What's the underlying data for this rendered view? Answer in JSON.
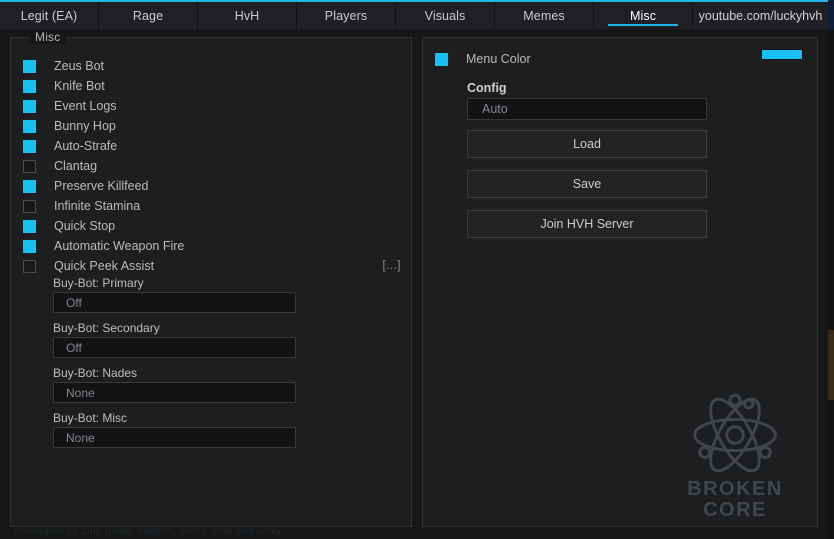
{
  "window": {
    "accent_color": "#20b4e8",
    "background": "#151719"
  },
  "tabs": [
    {
      "label": "Legit (EA)",
      "active": false
    },
    {
      "label": "Rage",
      "active": false
    },
    {
      "label": "HvH",
      "active": false
    },
    {
      "label": "Players",
      "active": false
    },
    {
      "label": "Visuals",
      "active": false
    },
    {
      "label": "Memes",
      "active": false
    },
    {
      "label": "Misc",
      "active": true
    }
  ],
  "tab_url": "youtube.com/luckyhvh",
  "left_panel": {
    "title": "Misc",
    "checkboxes": [
      {
        "label": "Zeus Bot",
        "checked": true
      },
      {
        "label": "Knife Bot",
        "checked": true
      },
      {
        "label": "Event Logs",
        "checked": true
      },
      {
        "label": "Bunny Hop",
        "checked": true
      },
      {
        "label": "Auto-Strafe",
        "checked": true
      },
      {
        "label": "Clantag",
        "checked": false
      },
      {
        "label": "Preserve Killfeed",
        "checked": true
      },
      {
        "label": "Infinite Stamina",
        "checked": false
      },
      {
        "label": "Quick Stop",
        "checked": true
      },
      {
        "label": "Automatic Weapon Fire",
        "checked": true
      },
      {
        "label": "Quick Peek Assist",
        "checked": false,
        "more": "[...]"
      }
    ],
    "fields": [
      {
        "label": "Buy-Bot: Primary",
        "value": "Off"
      },
      {
        "label": "Buy-Bot: Secondary",
        "value": "Off"
      },
      {
        "label": "Buy-Bot: Nades",
        "value": "None"
      },
      {
        "label": "Buy-Bot: Misc",
        "value": "None"
      }
    ]
  },
  "right_panel": {
    "menu_color": {
      "label": "Menu Color",
      "checked": true,
      "swatch_color": "#18c0f4"
    },
    "config": {
      "label": "Config",
      "value": "Auto"
    },
    "buttons": [
      {
        "label": "Load"
      },
      {
        "label": "Save"
      },
      {
        "label": "Join HVH Server"
      }
    ]
  },
  "watermark": {
    "icon": "atom-icon",
    "line1": "BROKEN",
    "line2": "CORE"
  },
  "credit": "developed by zim, polak, badster, swiss, estk and lucky"
}
